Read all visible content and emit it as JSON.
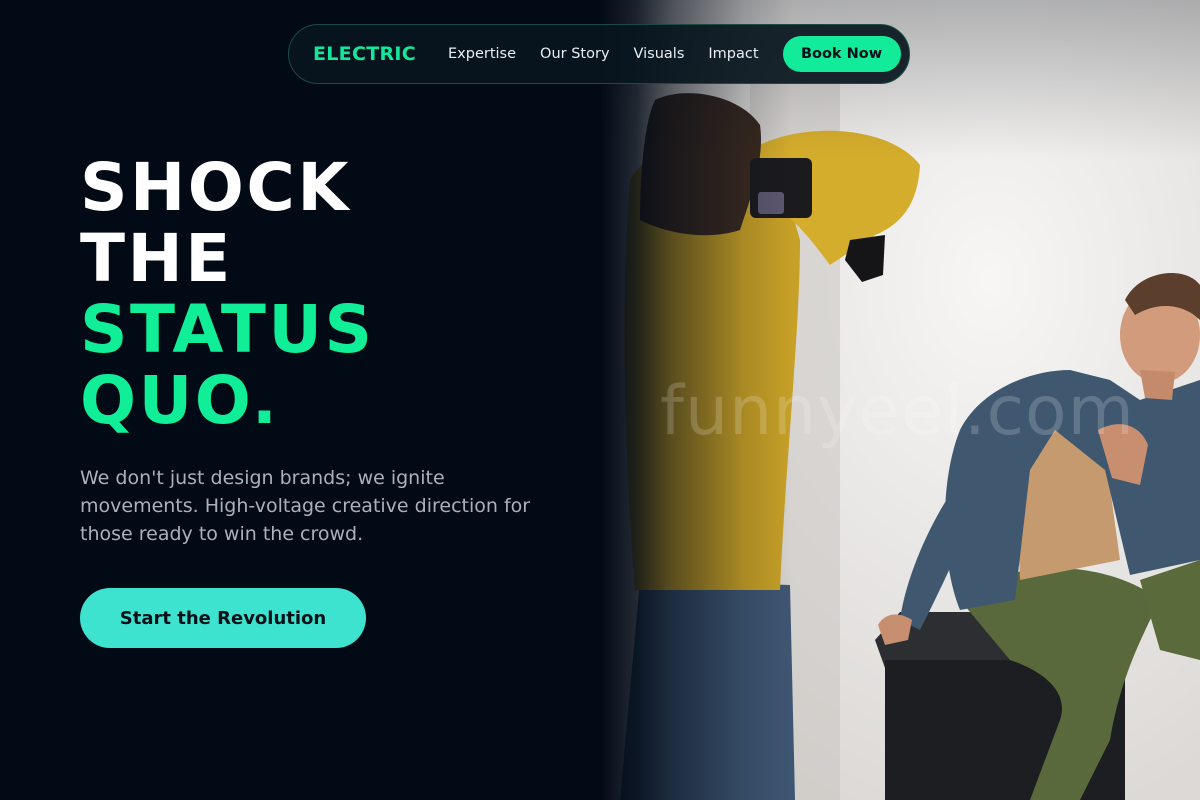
{
  "nav": {
    "brand": "ELECTRIC",
    "links": [
      {
        "label": "Expertise"
      },
      {
        "label": "Our Story"
      },
      {
        "label": "Visuals"
      },
      {
        "label": "Impact"
      }
    ],
    "book_label": "Book Now"
  },
  "hero": {
    "headline": [
      "SHOCK",
      "THE",
      "STATUS",
      "QUO."
    ],
    "subtext": "We don't just design brands; we ignite movements. High-voltage creative direction for those ready to win the crowd.",
    "cta_label": "Start the Revolution"
  },
  "photo": {
    "watermark": "funnyeel.com"
  },
  "colors": {
    "background": "#020a16",
    "accent_green": "#10ee98",
    "cta_teal": "#3de3cf",
    "muted_text": "#a9b1bd"
  }
}
